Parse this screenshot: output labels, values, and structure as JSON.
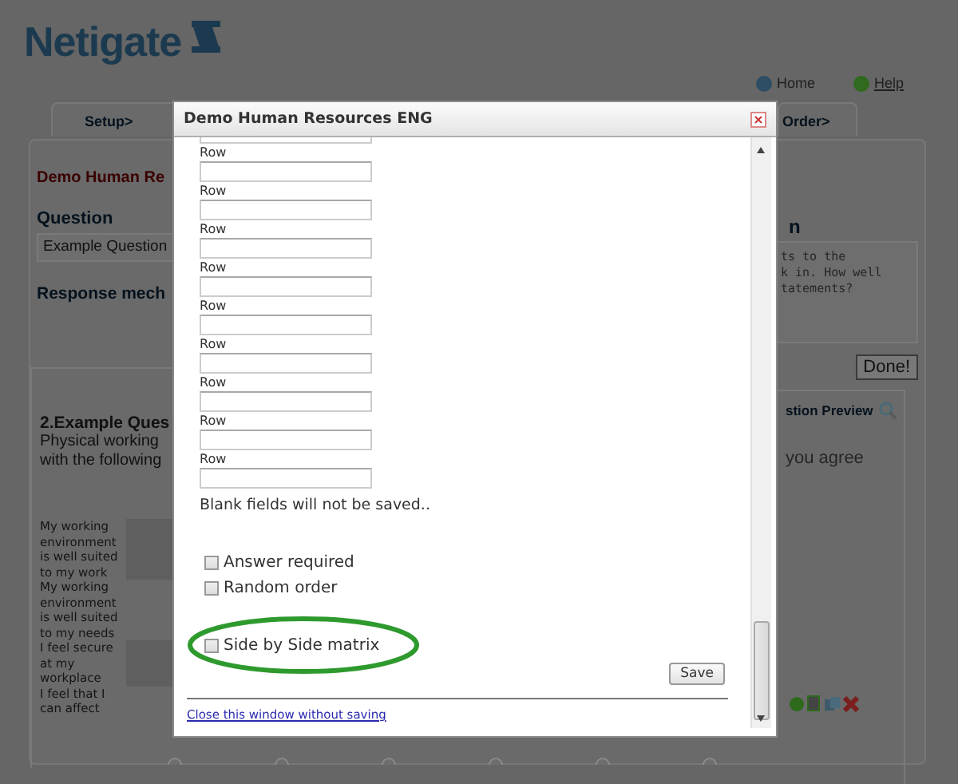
{
  "logo": {
    "text": "Netigate"
  },
  "nav_links": [
    {
      "label": "Home",
      "kind": "home"
    },
    {
      "label": "Help",
      "kind": "help"
    }
  ],
  "tabs": [
    {
      "label": "Setup>",
      "selected": false
    },
    {
      "label": "Order>",
      "selected": false
    }
  ],
  "survey_title": "Demo Human Re",
  "question_label": "Question",
  "question_field": {
    "value": "Example Question"
  },
  "response_label": "Response mech",
  "preview": {
    "heading": "2.Example Ques",
    "text_lines": [
      "Physical working",
      "with the following"
    ],
    "statements": [
      {
        "text": "My working environment is well suited to my work"
      },
      {
        "text": "My working environment is well suited to my needs"
      },
      {
        "text": "I feel secure at my workplace"
      },
      {
        "text": "I feel that I can affect"
      }
    ]
  },
  "matrix_radios": [
    {
      "selected": false
    },
    {
      "selected": false
    },
    {
      "selected": false
    },
    {
      "selected": false
    },
    {
      "selected": false
    },
    {
      "selected": false
    }
  ],
  "right": {
    "heading": "n",
    "description_lines": [
      "ts to the",
      "k in. How well",
      "tatements?"
    ],
    "done_button": "Done!",
    "preview_link": "stion Preview",
    "text": "you agree"
  },
  "dialog": {
    "title": "Demo Human Resources ENG",
    "rows": [
      {
        "label": "Row"
      },
      {
        "label": "Row"
      },
      {
        "label": "Row"
      },
      {
        "label": "Row"
      },
      {
        "label": "Row"
      },
      {
        "label": "Row"
      },
      {
        "label": "Row"
      },
      {
        "label": "Row"
      },
      {
        "label": "Row"
      }
    ],
    "note": "Blank fields will not be saved..",
    "options": [
      {
        "label": "Answer required",
        "checked": false,
        "highlighted": false
      },
      {
        "label": "Random order",
        "checked": false,
        "highlighted": false
      },
      {
        "label": "Side by Side matrix",
        "checked": false,
        "highlighted": true
      }
    ],
    "save_button": "Save",
    "close_link": "Close this window without saving"
  }
}
